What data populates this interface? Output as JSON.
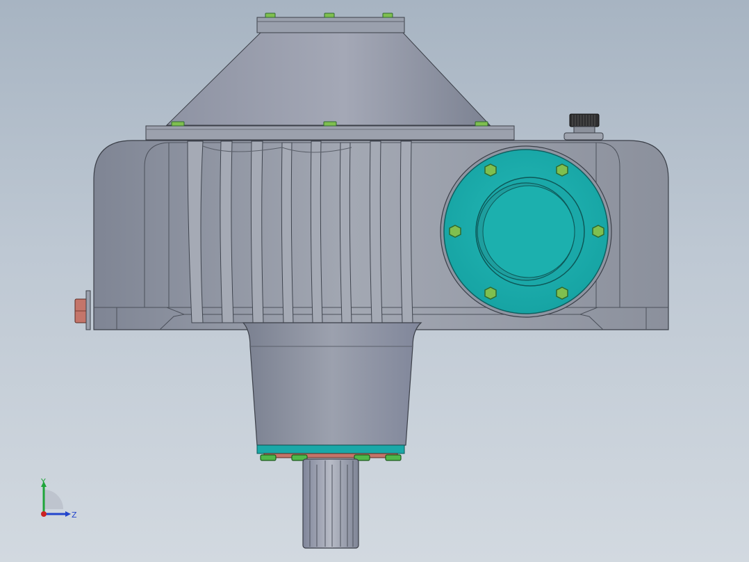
{
  "viewport": {
    "background_top": "#a7b4c2",
    "background_bottom": "#d2d9e0"
  },
  "model": {
    "housing_color": "#9aa0ab",
    "flange_color": "#1aaeae",
    "bolt_color": "#7fbf4f",
    "bolt_dark_color": "#2f8a2f",
    "side_bolt_color": "#c4756a",
    "knob_color": "#2a2a2a"
  },
  "triad": {
    "y_label": "Y",
    "z_label": "Z",
    "y_color": "#1fa53a",
    "z_color": "#2244cc",
    "x_color": "#cc2222"
  }
}
